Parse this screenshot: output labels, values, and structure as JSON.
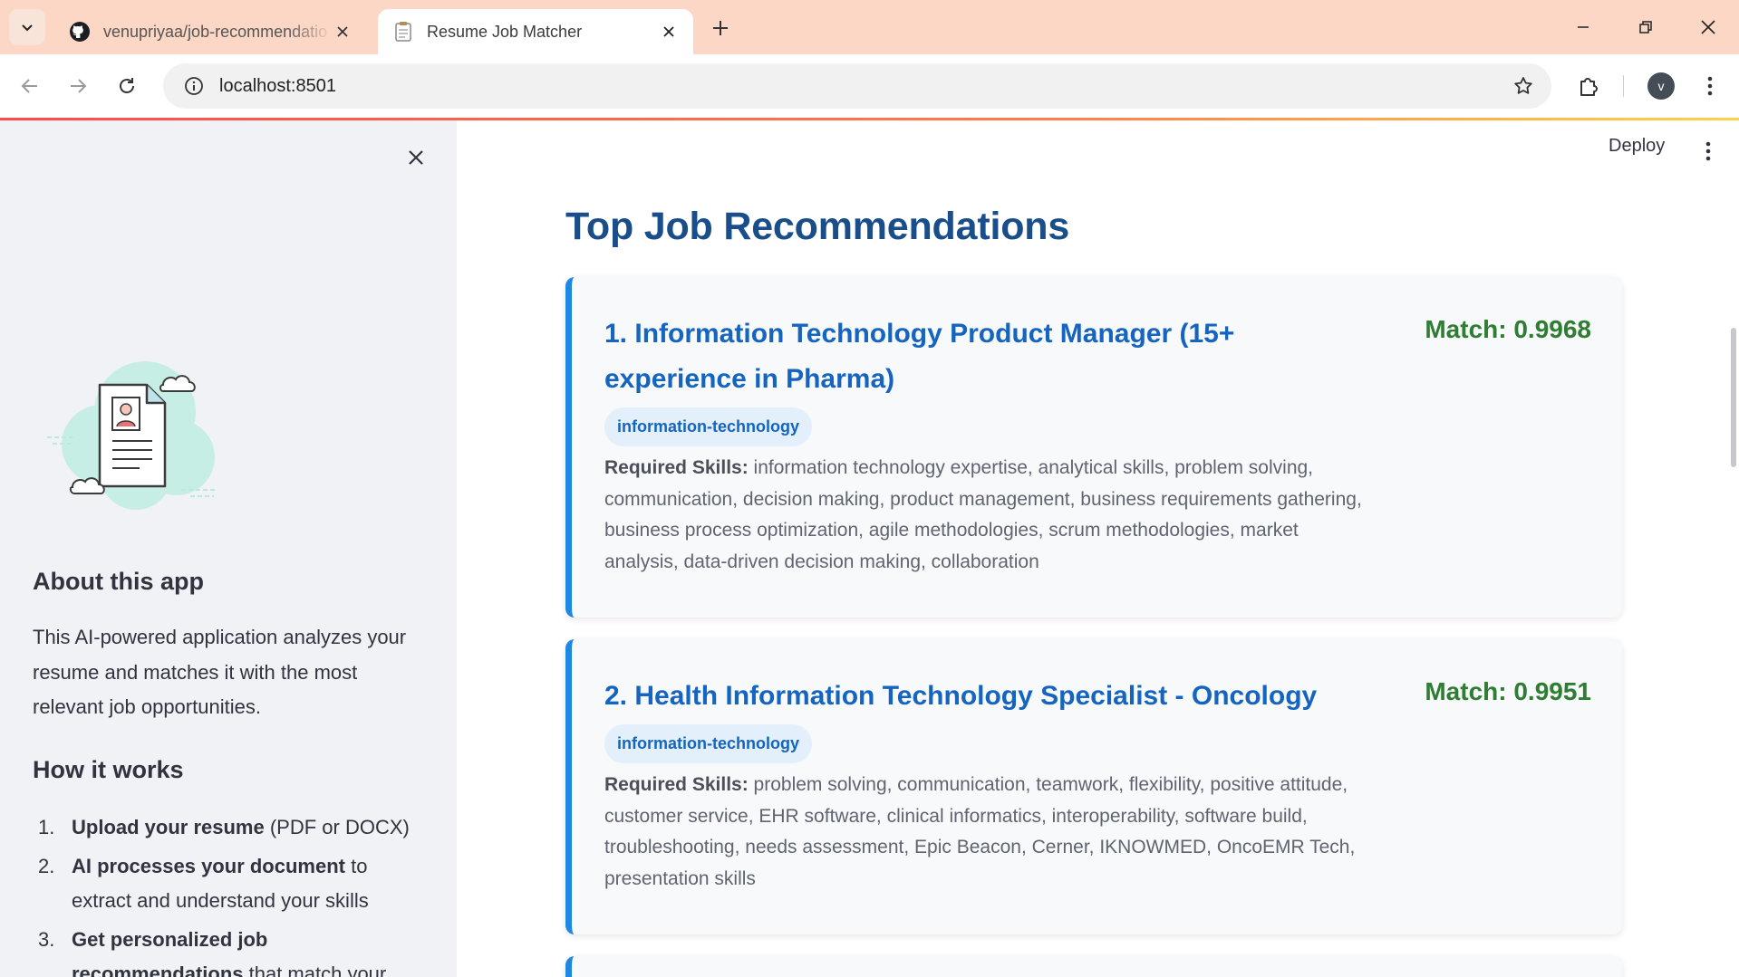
{
  "browser": {
    "tabs": [
      {
        "title": "venupriyaa/job-recommendatio",
        "icon": "github-icon",
        "active": false
      },
      {
        "title": "Resume Job Matcher",
        "icon": "document-icon",
        "active": true
      }
    ],
    "url": "localhost:8501",
    "profile_initial": "v"
  },
  "app": {
    "deploy_label": "Deploy",
    "sidebar": {
      "about_heading": "About this app",
      "about_text": "This AI-powered application analyzes your resume and matches it with the most relevant job opportunities.",
      "how_heading": "How it works",
      "steps": [
        {
          "num": "1.",
          "bold": "Upload your resume",
          "rest": " (PDF or DOCX)"
        },
        {
          "num": "2.",
          "bold": "AI processes your document",
          "rest": " to extract and understand your skills"
        },
        {
          "num": "3.",
          "bold": "Get personalized job recommendations",
          "rest": " that match your"
        }
      ]
    },
    "main": {
      "title": "Top Job Recommendations",
      "jobs": [
        {
          "title": "1. Information Technology Product Manager (15+ experience in Pharma)",
          "match": "Match: 0.9968",
          "category": "information-technology",
          "skills_label": "Required Skills:",
          "skills": " information technology expertise, analytical skills, problem solving, communication, decision making, product management, business requirements gathering, business process optimization, agile methodologies, scrum methodologies, market analysis, data-driven decision making, collaboration"
        },
        {
          "title": "2. Health Information Technology Specialist - Oncology",
          "match": "Match: 0.9951",
          "category": "information-technology",
          "skills_label": "Required Skills:",
          "skills": " problem solving, communication, teamwork, flexibility, positive attitude, customer service, EHR software, clinical informatics, interoperability, software build, troubleshooting, needs assessment, Epic Beacon, Cerner, IKNOWMED, OncoEMR Tech, presentation skills"
        }
      ]
    }
  },
  "colors": {
    "heading": "#1a4e8a",
    "job_title": "#1565c0",
    "match": "#2e7d32",
    "card_accent": "#1e88e5",
    "sidebar_bg": "#f0f2f6",
    "tabbar_bg": "#fdd7c5"
  }
}
